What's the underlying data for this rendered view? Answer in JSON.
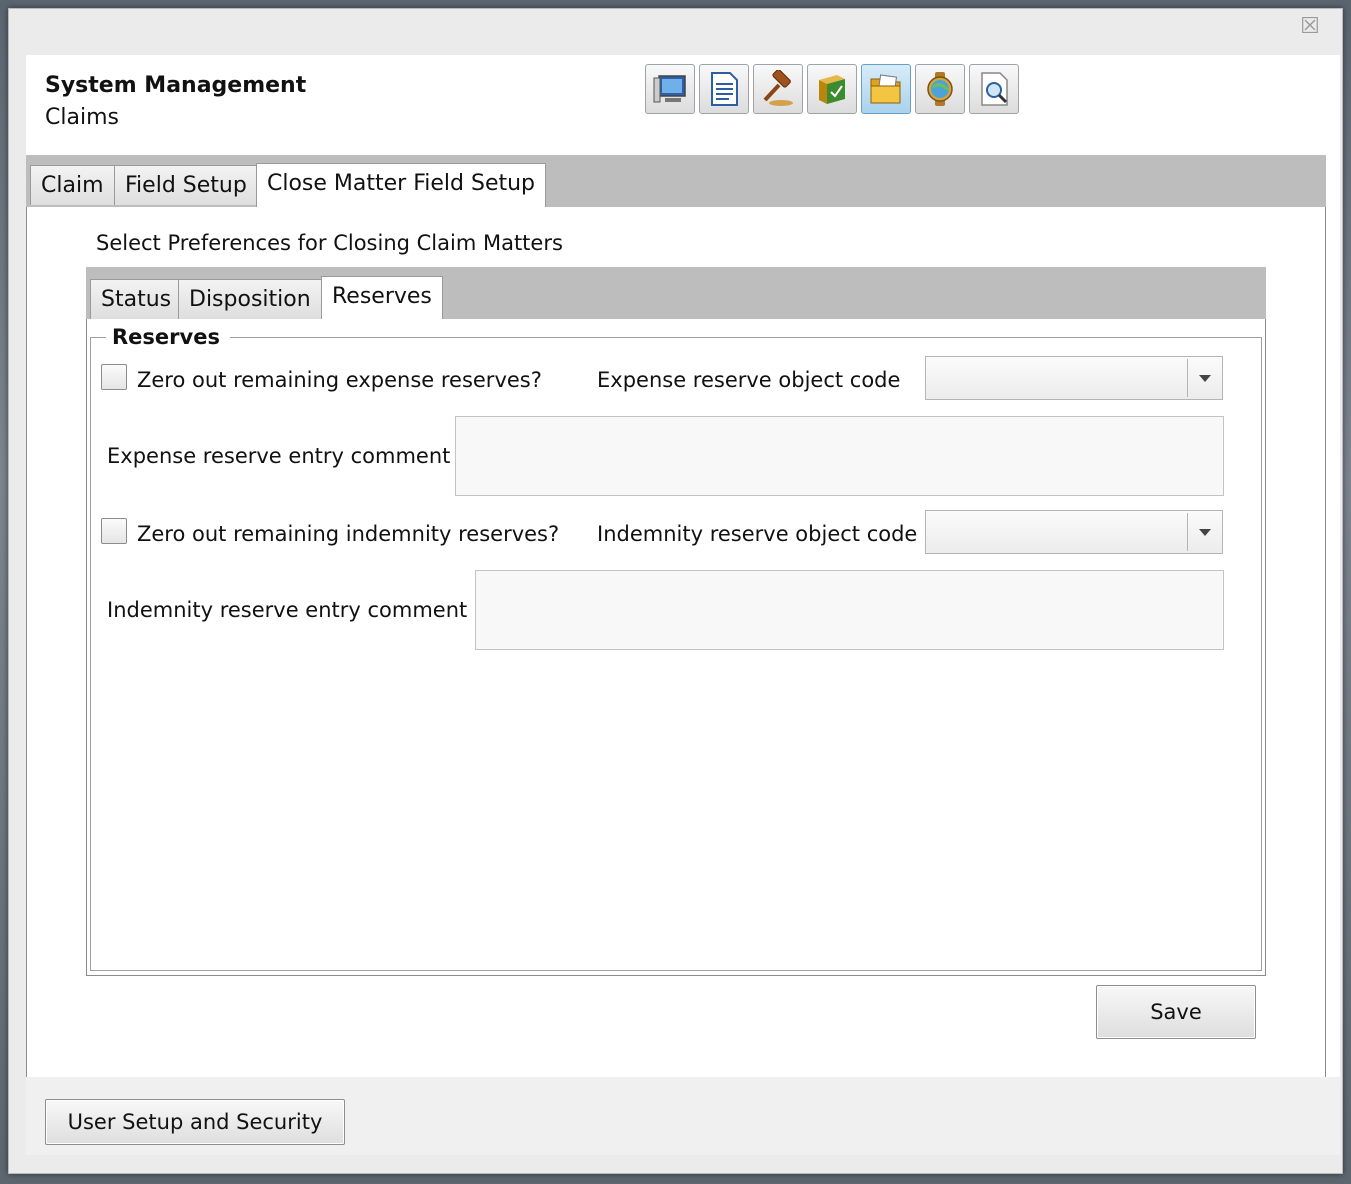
{
  "header": {
    "title": "System Management",
    "subtitle": "Claims"
  },
  "toolbar": {
    "icons": [
      "computer-icon",
      "document-icon",
      "gavel-icon",
      "book-icon",
      "folder-icon",
      "globe-watch-icon",
      "search-document-icon"
    ],
    "active_index": 4
  },
  "outer_tabs": [
    {
      "label": "Claim"
    },
    {
      "label": "Field Setup"
    },
    {
      "label": "Close Matter Field Setup"
    }
  ],
  "preferences_label": "Select Preferences for Closing Claim Matters",
  "inner_tabs": [
    {
      "label": "Status"
    },
    {
      "label": "Disposition"
    },
    {
      "label": "Reserves"
    }
  ],
  "reserves": {
    "group_title": "Reserves",
    "expense_checkbox_label": "Zero out remaining expense reserves?",
    "expense_checked": false,
    "expense_code_label": "Expense reserve object code",
    "expense_code_value": "",
    "expense_comment_label": "Expense reserve entry comment",
    "expense_comment_value": "",
    "indemnity_checkbox_label": "Zero out remaining indemnity reserves?",
    "indemnity_checked": false,
    "indemnity_code_label": "Indemnity reserve object code",
    "indemnity_code_value": "",
    "indemnity_comment_label": "Indemnity reserve entry comment",
    "indemnity_comment_value": ""
  },
  "buttons": {
    "save": "Save",
    "user_setup": "User Setup and Security"
  },
  "colors": {
    "tabbar_bg": "#bdbdbd",
    "active_toolbar_button": "#a9d2ee"
  }
}
